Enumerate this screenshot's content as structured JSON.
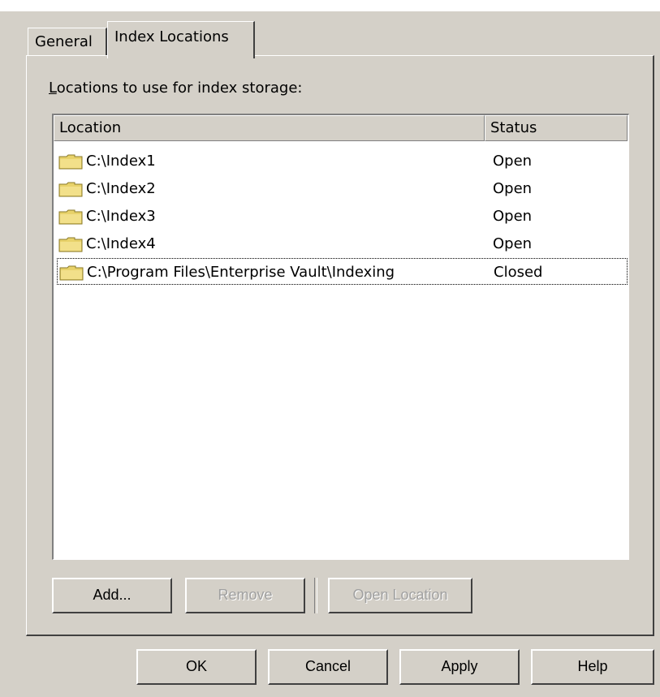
{
  "tabs": [
    {
      "label": "General"
    },
    {
      "label": "Index Locations"
    }
  ],
  "caption": {
    "prefix": "L",
    "rest": "ocations to use for index storage:"
  },
  "list": {
    "columns": [
      "Location",
      "Status"
    ],
    "rows": [
      {
        "location": "C:\\Index1",
        "status": "Open"
      },
      {
        "location": "C:\\Index2",
        "status": "Open"
      },
      {
        "location": "C:\\Index3",
        "status": "Open"
      },
      {
        "location": "C:\\Index4",
        "status": "Open"
      },
      {
        "location": "C:\\Program Files\\Enterprise Vault\\Indexing",
        "status": "Closed"
      }
    ]
  },
  "buttons": {
    "add": "Add...",
    "remove": "Remove",
    "open_location": "Open Location",
    "ok": "OK",
    "cancel": "Cancel",
    "apply": "Apply",
    "help": "Help"
  },
  "colors": {
    "window_bg": "#d4d0c8",
    "list_bg": "#ffffff",
    "folder": "#e8d26a"
  }
}
